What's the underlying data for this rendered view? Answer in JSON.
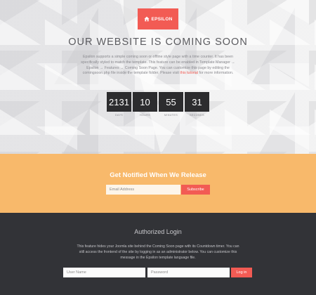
{
  "brand": {
    "logo_text": "EPSILON",
    "accent_color": "#f25b54",
    "icon": "home-icon"
  },
  "hero": {
    "title": "OUR WEBSITE IS COMING SOON",
    "description_before_link": "Epsilon supports a simple coming soon or offline style page with a time counter. It has been specifically styled to match the template. This feature can be enabled in Template Manager → Epsilon → Features → Coming Soon Page. You can customize this page by editing the comingsoon.php file inside the template folder. Please visit ",
    "description_link": "this tutorial",
    "description_after_link": " for more information."
  },
  "countdown": [
    {
      "value": "2131",
      "label": "DAYS"
    },
    {
      "value": "10",
      "label": "HOURS"
    },
    {
      "value": "55",
      "label": "MINUTES"
    },
    {
      "value": "31",
      "label": "SECONDS"
    }
  ],
  "notify": {
    "title": "Get Notified When We Release",
    "email_placeholder": "Email Address",
    "subscribe_label": "Subscribe",
    "background_color": "#f8b96b"
  },
  "login": {
    "title": "Authorized Login",
    "description": "This feature hides your Joomla site behind the Coming Soon page with its Countdown timer. You can still access the frontend of the site by logging in as an administrator below. You can customize this message in the Epsilon template language file.",
    "username_placeholder": "User Name",
    "password_placeholder": "Password",
    "button_label": "Log in",
    "background_color": "#323337"
  }
}
